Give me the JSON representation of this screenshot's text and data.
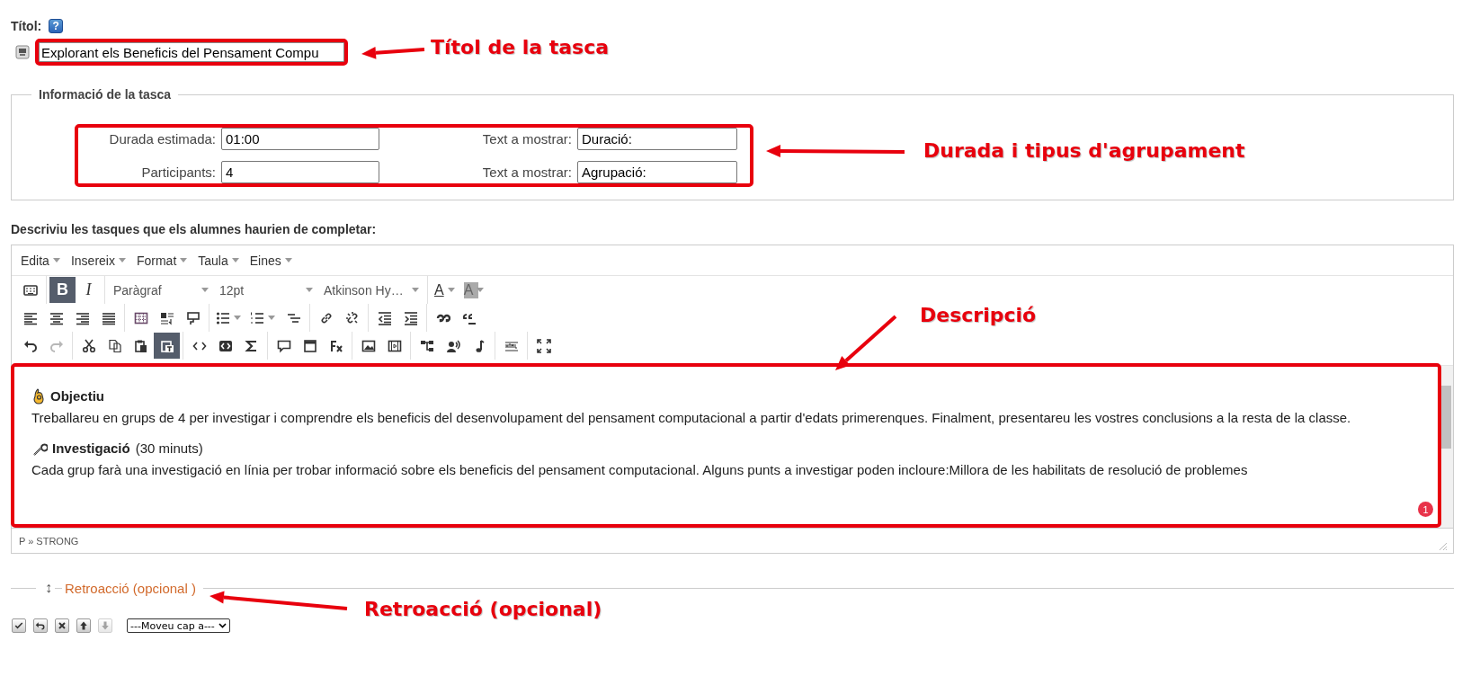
{
  "title_field": {
    "label": "Títol:",
    "help": "?",
    "value": "Explorant els Beneficis del Pensament Compu"
  },
  "task_info": {
    "legend": "Informació de la tasca",
    "rows": [
      {
        "label": "Durada estimada:",
        "value": "01:00",
        "display_label": "Text a mostrar:",
        "display_value": "Duració:"
      },
      {
        "label": "Participants:",
        "value": "4",
        "display_label": "Text a mostrar:",
        "display_value": "Agrupació:"
      }
    ]
  },
  "description": {
    "label": "Descriviu les tasques que els alumnes haurien de completar:",
    "menus": [
      "Edita",
      "Insereix",
      "Format",
      "Taula",
      "Eines"
    ],
    "toolbars": [
      [
        [
          {
            "kind": "button",
            "active": false,
            "disabled": false
          }
        ],
        [
          {
            "kind": "letter",
            "label": "B",
            "active": true,
            "disabled": false
          },
          {
            "kind": "letter",
            "label": "I",
            "active": false,
            "disabled": false
          }
        ],
        [
          {
            "kind": "select",
            "value": "Paràgraf"
          },
          {
            "kind": "select",
            "value": "12pt"
          },
          {
            "kind": "select",
            "value": "Atkinson Hy…"
          }
        ],
        [
          {
            "kind": "letter_split",
            "label": "A",
            "active": false,
            "disabled": false
          },
          {
            "kind": "letter_split",
            "label": "A",
            "active": false,
            "disabled": false
          }
        ]
      ],
      [
        [
          {
            "kind": "button",
            "active": false,
            "disabled": false
          },
          {
            "kind": "button",
            "active": false,
            "disabled": false
          },
          {
            "kind": "button",
            "active": false,
            "disabled": false
          },
          {
            "kind": "button",
            "active": false,
            "disabled": false
          }
        ],
        [
          {
            "kind": "button",
            "active": false,
            "disabled": false
          },
          {
            "kind": "button",
            "active": false,
            "disabled": false
          },
          {
            "kind": "button",
            "active": false,
            "disabled": false
          }
        ],
        [
          {
            "kind": "split",
            "active": false,
            "disabled": false
          },
          {
            "kind": "split",
            "active": false,
            "disabled": false
          },
          {
            "kind": "button",
            "active": false,
            "disabled": false
          }
        ],
        [
          {
            "kind": "button",
            "active": false,
            "disabled": false
          },
          {
            "kind": "button",
            "active": false,
            "disabled": false
          }
        ],
        [
          {
            "kind": "button",
            "active": false,
            "disabled": false
          },
          {
            "kind": "button",
            "active": false,
            "disabled": false
          }
        ],
        [
          {
            "kind": "button",
            "active": false,
            "disabled": false
          },
          {
            "kind": "button",
            "active": false,
            "disabled": false
          }
        ]
      ],
      [
        [
          {
            "kind": "button",
            "active": false,
            "disabled": false
          },
          {
            "kind": "button",
            "active": false,
            "disabled": true
          }
        ],
        [
          {
            "kind": "button",
            "active": false,
            "disabled": false
          },
          {
            "kind": "button",
            "active": false,
            "disabled": false
          },
          {
            "kind": "button",
            "active": false,
            "disabled": false
          },
          {
            "kind": "button",
            "active": true,
            "disabled": false
          }
        ],
        [
          {
            "kind": "button",
            "active": false,
            "disabled": false
          },
          {
            "kind": "button",
            "active": false,
            "disabled": false
          },
          {
            "kind": "button",
            "active": false,
            "disabled": false
          }
        ],
        [
          {
            "kind": "button",
            "active": false,
            "disabled": false
          },
          {
            "kind": "button",
            "active": false,
            "disabled": false
          },
          {
            "kind": "button",
            "active": false,
            "disabled": false
          }
        ],
        [
          {
            "kind": "button",
            "active": false,
            "disabled": false
          },
          {
            "kind": "button",
            "active": false,
            "disabled": false
          }
        ],
        [
          {
            "kind": "button",
            "active": false,
            "disabled": false
          },
          {
            "kind": "button",
            "active": false,
            "disabled": false
          },
          {
            "kind": "button",
            "active": false,
            "disabled": false
          }
        ],
        [
          {
            "kind": "button",
            "active": false,
            "disabled": false
          }
        ],
        [
          {
            "kind": "button",
            "active": false,
            "disabled": false
          }
        ]
      ]
    ],
    "content": [
      {
        "kind": "section",
        "title": "Objectiu"
      },
      {
        "kind": "paragraph",
        "text": "Treballareu en grups de 4 per investigar i comprendre els beneficis del desenvolupament del pensament computacional a partir d'edats primerenques. Finalment, presentareu les vostres conclusions a la resta de la classe."
      },
      {
        "kind": "section",
        "title": "Investigació",
        "note": "(30 minuts)"
      },
      {
        "kind": "paragraph",
        "text": "Cada grup farà una investigació en línia per trobar informació sobre els beneficis del pensament computacional. Alguns punts a investigar poden incloure:Millora de les habilitats de resolució de problemes"
      }
    ],
    "badge": "1",
    "path": "P » STRONG"
  },
  "feedback": {
    "toggle": "↕",
    "legend": "Retroacció (opcional )"
  },
  "actions": [
    {
      "disabled": false
    },
    {
      "disabled": false
    },
    {
      "disabled": false
    },
    {
      "disabled": false
    },
    {
      "disabled": true
    }
  ],
  "move_select": "---Moveu cap a---",
  "annotations": [
    {
      "text": "Títol de la tasca"
    },
    {
      "text": "Durada i tipus d'agrupament"
    },
    {
      "text": "Descripció"
    },
    {
      "text": "Retroacció (opcional)"
    }
  ]
}
